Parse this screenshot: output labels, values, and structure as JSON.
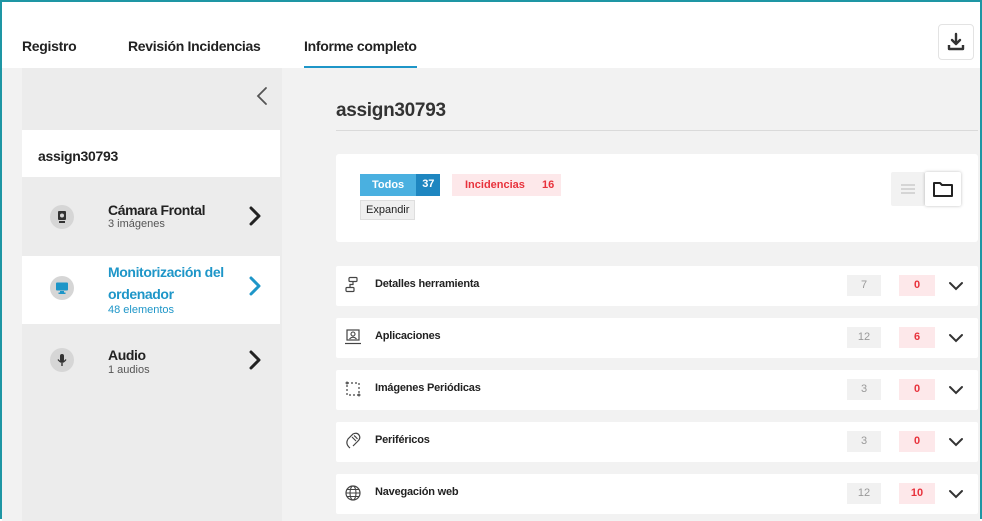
{
  "tabs": [
    {
      "label": "Registro",
      "active": false
    },
    {
      "label": "Revisión Incidencias",
      "active": false
    },
    {
      "label": "Informe completo",
      "active": true
    }
  ],
  "sidebar": {
    "assign_id": "assign30793",
    "items": [
      {
        "title": "Cámara Frontal",
        "subtitle": "3 imágenes",
        "icon": "webcam-icon",
        "active": false
      },
      {
        "title_line1": "Monitorización del",
        "title_line2": "ordenador",
        "subtitle": "48 elementos",
        "icon": "monitor-icon",
        "active": true
      },
      {
        "title": "Audio",
        "subtitle": "1 audios",
        "icon": "microphone-icon",
        "active": false
      }
    ]
  },
  "main": {
    "heading": "assign30793",
    "filters": {
      "all_label": "Todos",
      "all_count": "37",
      "incidents_label": "Incidencias",
      "incidents_count": "16",
      "expand_label": "Expandir"
    },
    "rows": [
      {
        "label": "Detalles herramienta",
        "total": "7",
        "incidents": "0",
        "icon": "tool-details-icon"
      },
      {
        "label": "Aplicaciones",
        "total": "12",
        "incidents": "6",
        "icon": "applications-icon"
      },
      {
        "label": "Imágenes Periódicas",
        "total": "3",
        "incidents": "0",
        "icon": "periodic-images-icon"
      },
      {
        "label": "Periféricos",
        "total": "3",
        "incidents": "0",
        "icon": "peripherals-icon"
      },
      {
        "label": "Navegación web",
        "total": "12",
        "incidents": "10",
        "icon": "globe-icon"
      }
    ]
  },
  "colors": {
    "accent": "#1e96c8",
    "incident_red": "#e8323c",
    "incident_bg": "#fde8ea",
    "frame_border": "#1e96a4"
  }
}
